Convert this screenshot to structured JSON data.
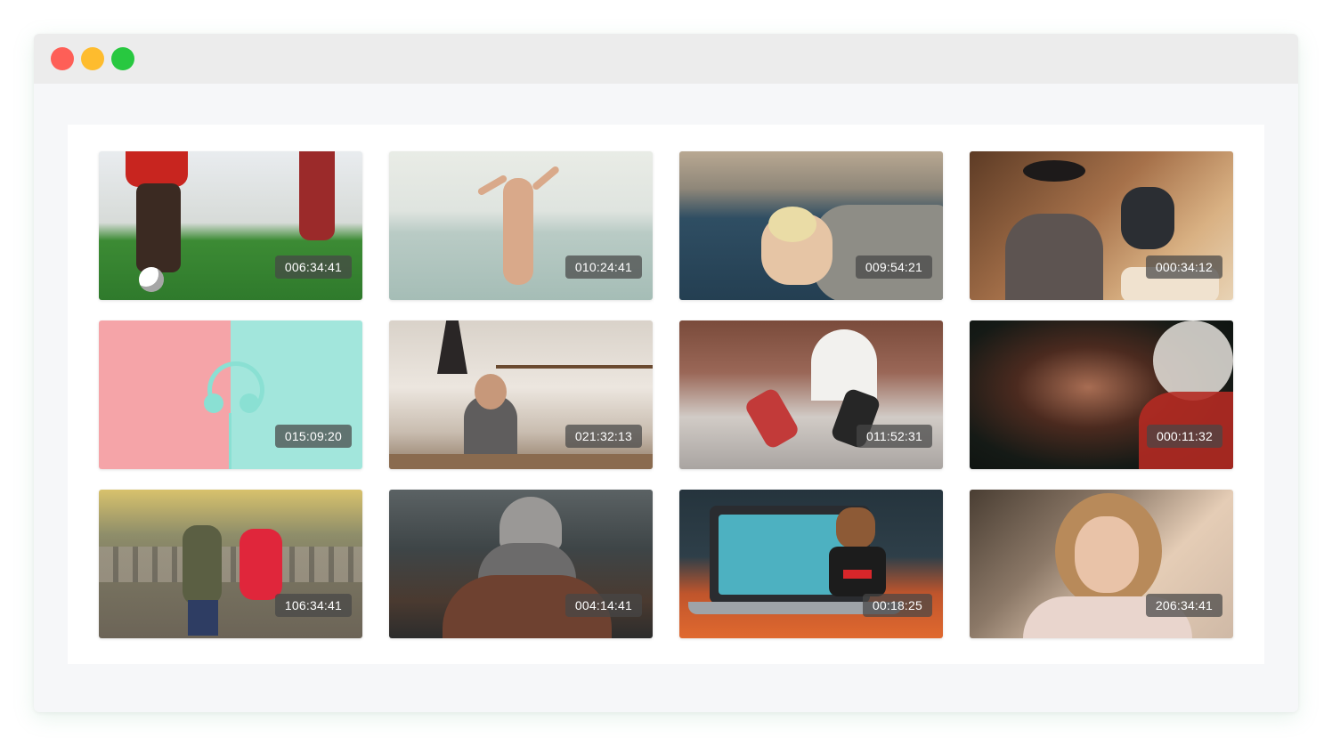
{
  "window": {
    "controls": {
      "close_color": "#fe5f57",
      "minimize_color": "#febc2e",
      "zoom_color": "#28c840"
    }
  },
  "gallery": {
    "items": [
      {
        "icon": "soccer-photo",
        "duration": "006:34:41"
      },
      {
        "icon": "beach-photo",
        "duration": "010:24:41"
      },
      {
        "icon": "lake-photo",
        "duration": "009:54:21"
      },
      {
        "icon": "dinner-photo",
        "duration": "000:34:12"
      },
      {
        "icon": "headphones-photo",
        "duration": "015:09:20"
      },
      {
        "icon": "kitchen-photo",
        "duration": "021:32:13"
      },
      {
        "icon": "gym-photo",
        "duration": "011:52:31"
      },
      {
        "icon": "portrait-photo",
        "duration": "000:11:32"
      },
      {
        "icon": "kids-photo",
        "duration": "106:34:41"
      },
      {
        "icon": "hiker-photo",
        "duration": "004:14:41"
      },
      {
        "icon": "laptop-photo",
        "duration": "00:18:25"
      },
      {
        "icon": "curly-hair-photo",
        "duration": "206:34:41"
      }
    ]
  }
}
